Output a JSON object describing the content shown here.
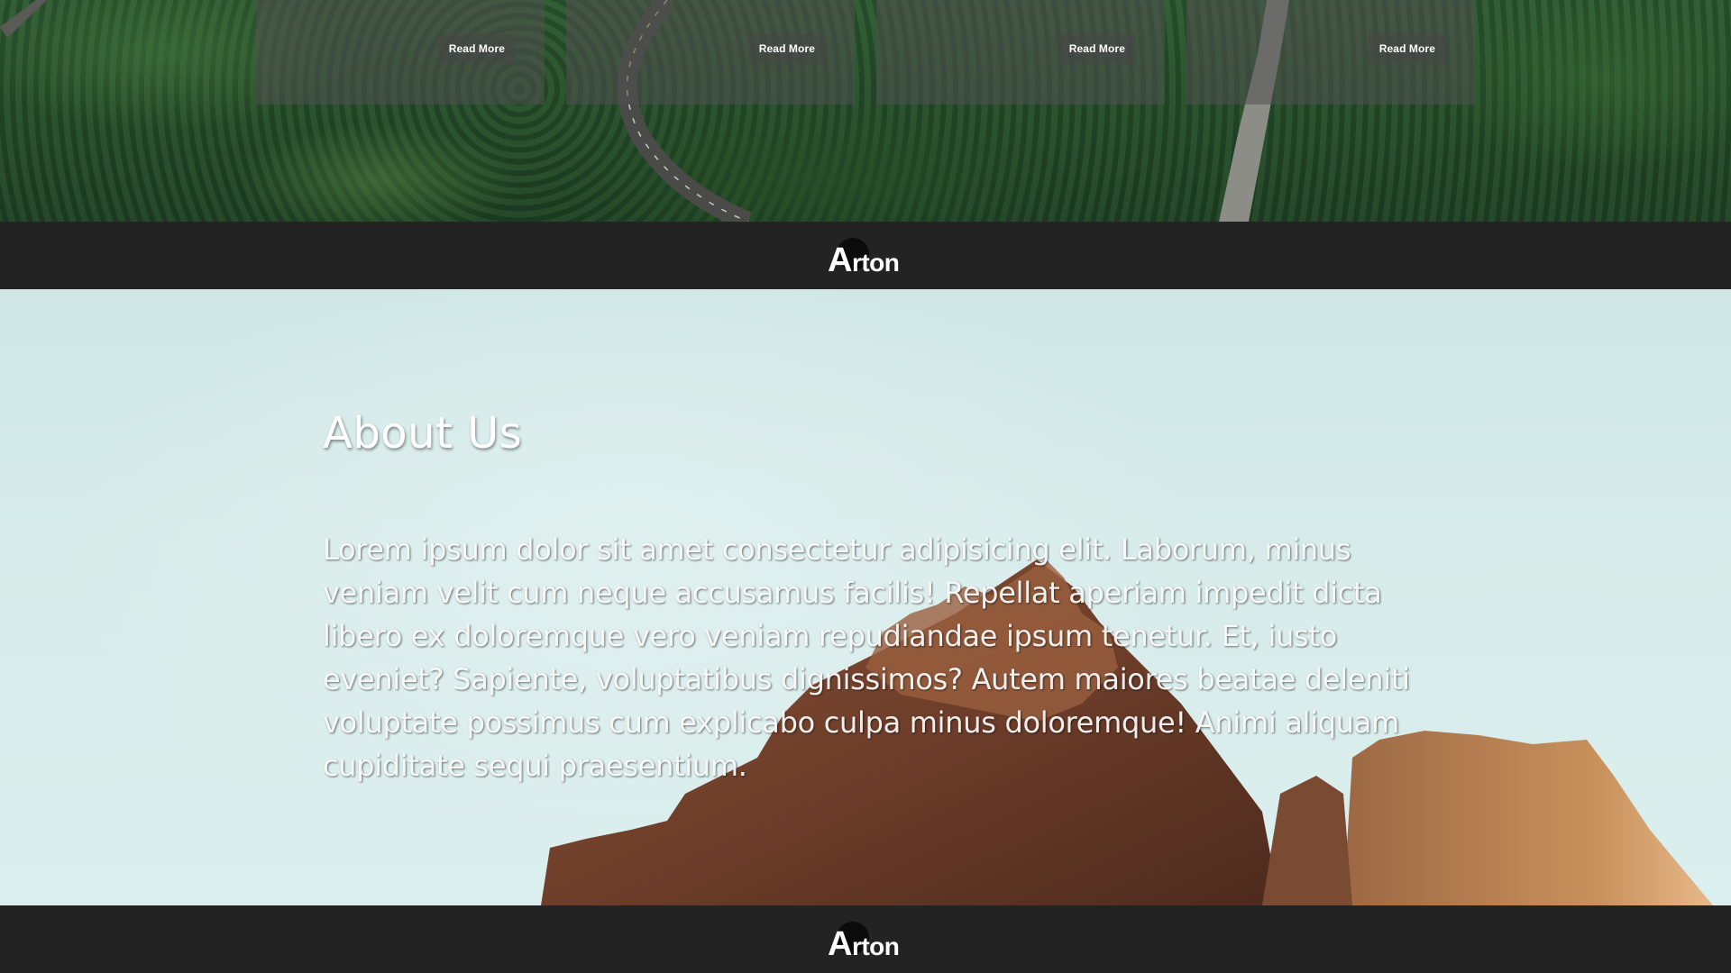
{
  "cards": [
    {
      "button_label": "Read More"
    },
    {
      "button_label": "Read More"
    },
    {
      "button_label": "Read More"
    },
    {
      "button_label": "Read More"
    }
  ],
  "brand": {
    "first_letter": "A",
    "rest": "rton"
  },
  "about": {
    "title": "About Us",
    "body": "Lorem ipsum dolor sit amet consectetur adipisicing elit. Laborum, minus veniam velit cum neque accusamus facilis! Repellat aperiam impedit dicta libero ex doloremque vero veniam repudiandae ipsum tenetur. Et, iusto eveniet? Sapiente, voluptatibus dignissimos? Autem maiores beatae deleniti voluptate possimus cum explicabo culpa minus doloremque! Animi aliquam cupiditate sequi praesentium."
  },
  "colors": {
    "bar_background": "#232323",
    "forest_green": "#264b2b",
    "sky": "#d7ecea",
    "rock": "#7a4a32"
  }
}
